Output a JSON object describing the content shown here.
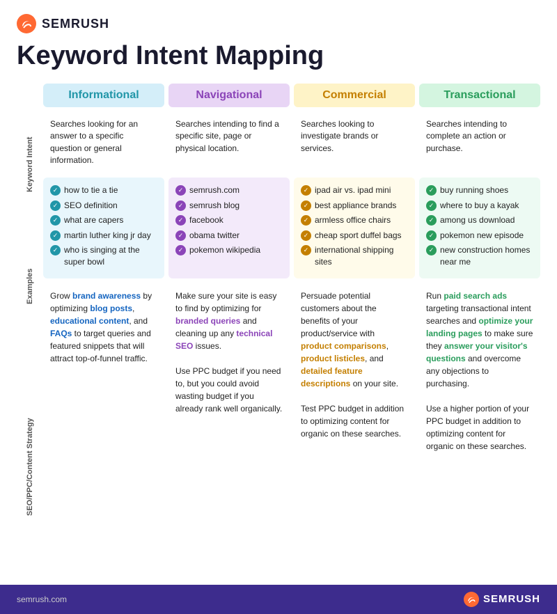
{
  "header": {
    "logo_text": "SEMRUSH",
    "title": "Keyword Intent Mapping"
  },
  "row_labels": {
    "keyword_intent": "Keyword Intent",
    "examples": "Examples",
    "strategy": "SEO/PPC/Content Strategy"
  },
  "columns": {
    "informational": {
      "label": "Informational",
      "description": "Searches looking for an answer to a specific question or general information.",
      "examples": [
        "how to tie a tie",
        "SEO definition",
        "what are capers",
        "martin luther king jr day",
        "who is singing at the super bowl"
      ],
      "strategy_html": true
    },
    "navigational": {
      "label": "Navigational",
      "description": "Searches intending to find a specific site, page or physical location.",
      "examples": [
        "semrush.com",
        "semrush blog",
        "facebook",
        "obama twitter",
        "pokemon wikipedia"
      ],
      "strategy_html": true
    },
    "commercial": {
      "label": "Commercial",
      "description": "Searches looking to investigate brands or services.",
      "examples": [
        "ipad air vs. ipad mini",
        "best appliance brands",
        "armless office chairs",
        "cheap sport duffel bags",
        "international shipping sites"
      ],
      "strategy_html": true
    },
    "transactional": {
      "label": "Transactional",
      "description": "Searches intending to complete an action or purchase.",
      "examples": [
        "buy running shoes",
        "where to buy a kayak",
        "among us download",
        "pokemon new episode",
        "new construction homes near me"
      ],
      "strategy_html": true
    }
  },
  "footer": {
    "url": "semrush.com",
    "logo_text": "SEMRUSH"
  }
}
